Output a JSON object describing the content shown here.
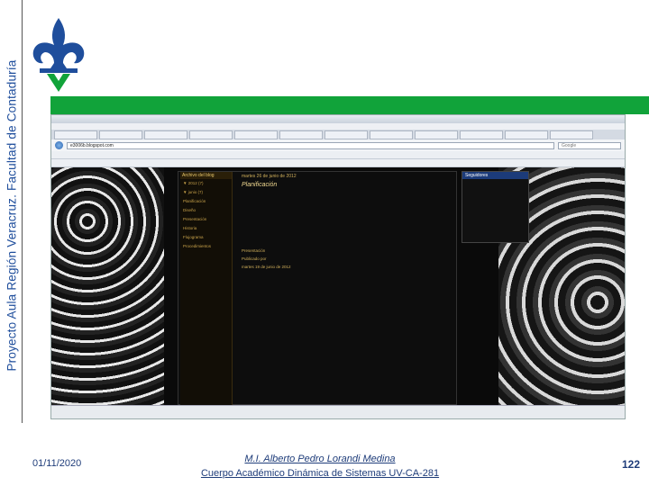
{
  "banner": {
    "vertical_title": "Proyecto Aula Región Veracruz. Facultad de Contaduría"
  },
  "colors": {
    "banner_text": "#1f4e9c",
    "accent_green": "#11a33a",
    "footer_text": "#1f3d7a"
  },
  "logo": {
    "icon": "fleur-de-lis-logo-icon"
  },
  "screenshot": {
    "address": "e3006b.blogspot.com",
    "search_placeholder": "Google",
    "blog": {
      "archive_title": "Archivo del blog",
      "archive_items": [
        "▼ 2012 (7)",
        "▼ junio (7)",
        "Planificación",
        "Diseño",
        "Presentación",
        "Historia",
        "Flujograma",
        "Procedimientos"
      ],
      "post_date": "martes 26 de junio de 2012",
      "post_title": "Planificación",
      "post_subtitle": "Presentación",
      "post_footer": "Publicado por",
      "post_date_2": "martes 19 de junio de 2012",
      "followers_title": "Seguidores"
    }
  },
  "footer": {
    "date": "01/11/2020",
    "author": "M.I. Alberto Pedro Lorandi Medina",
    "group": "Cuerpo Académico Dinámica de Sistemas UV-CA-281",
    "page_number": "122"
  }
}
